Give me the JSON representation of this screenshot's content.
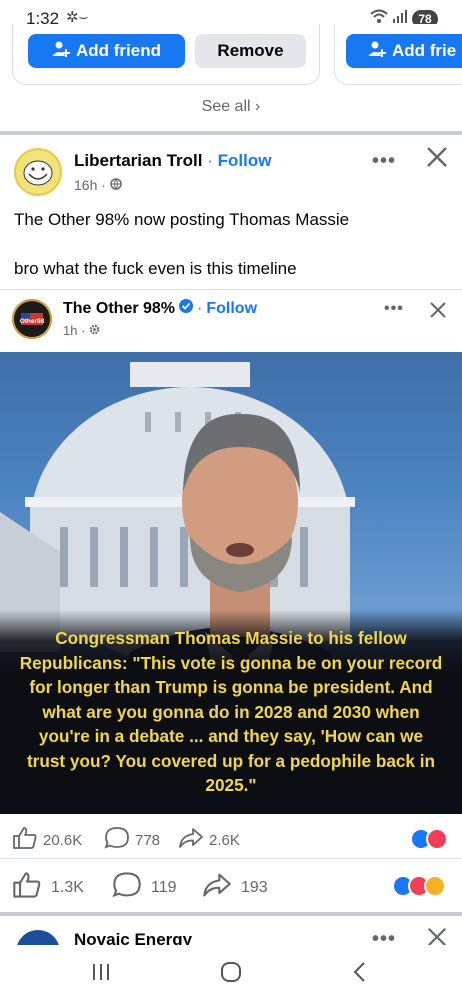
{
  "status_bar": {
    "time": "1:32",
    "battery": "78"
  },
  "friend_suggestions": {
    "add_friend_label": "Add friend",
    "remove_label": "Remove",
    "add_friend_partial_label": "Add frie",
    "see_all_label": "See all"
  },
  "share_post": {
    "author": "Libertarian Troll",
    "follow_label": "Follow",
    "time": "16h",
    "text_line1": "The Other 98% now posting Thomas Massie",
    "text_line2": "bro what the fuck even is this timeline"
  },
  "original_post": {
    "author": "The Other 98%",
    "follow_label": "Follow",
    "time": "1h",
    "avatar_text": "Other98",
    "caption": "Congressman Thomas Massie to his fellow Republicans: \"This vote is gonna be on your record for longer than Trump is gonna be president. And what are you gonna do in 2028 and 2030 when you're in a debate ... and they say, 'How can we trust you? You covered up for a pedophile back in 2025.\""
  },
  "original_stats": {
    "likes": "20.6K",
    "comments": "778",
    "shares": "2.6K"
  },
  "share_stats": {
    "likes": "1.3K",
    "comments": "119",
    "shares": "193"
  },
  "next_post": {
    "author": "Novaic Energy"
  },
  "colors": {
    "accent": "#1877f2",
    "caption": "#f2d64b"
  }
}
